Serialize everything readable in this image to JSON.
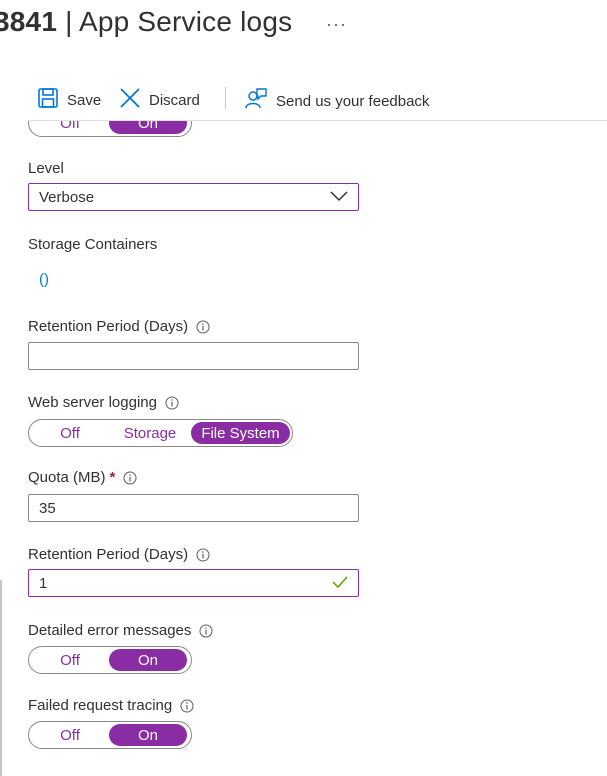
{
  "header": {
    "title_prefix": "3841",
    "title_sep": " | ",
    "title_main": "App Service logs",
    "more": "···"
  },
  "toolbar": {
    "save_label": "Save",
    "discard_label": "Discard",
    "feedback_label": "Send us your feedback"
  },
  "app_logging_toggle": {
    "off": "Off",
    "on": "On",
    "selected": "On"
  },
  "level": {
    "label": "Level",
    "value": "Verbose"
  },
  "storage_containers": {
    "label": "Storage Containers",
    "value": "()"
  },
  "retention_app": {
    "label": "Retention Period (Days)",
    "value": ""
  },
  "web_server_logging": {
    "label": "Web server logging",
    "options": [
      "Off",
      "Storage",
      "File System"
    ],
    "selected": "File System"
  },
  "quota": {
    "label": "Quota (MB)",
    "required_mark": "*",
    "value": "35"
  },
  "retention_web": {
    "label": "Retention Period (Days)",
    "value": "1"
  },
  "detailed_errors": {
    "label": "Detailed error messages",
    "off": "Off",
    "on": "On",
    "selected": "On"
  },
  "failed_request": {
    "label": "Failed request tracing",
    "off": "Off",
    "on": "On",
    "selected": "On"
  },
  "colors": {
    "accent": "#8a2da5",
    "link": "#0078d4",
    "valid": "#57a300",
    "brand_icon": "#0078d4"
  }
}
